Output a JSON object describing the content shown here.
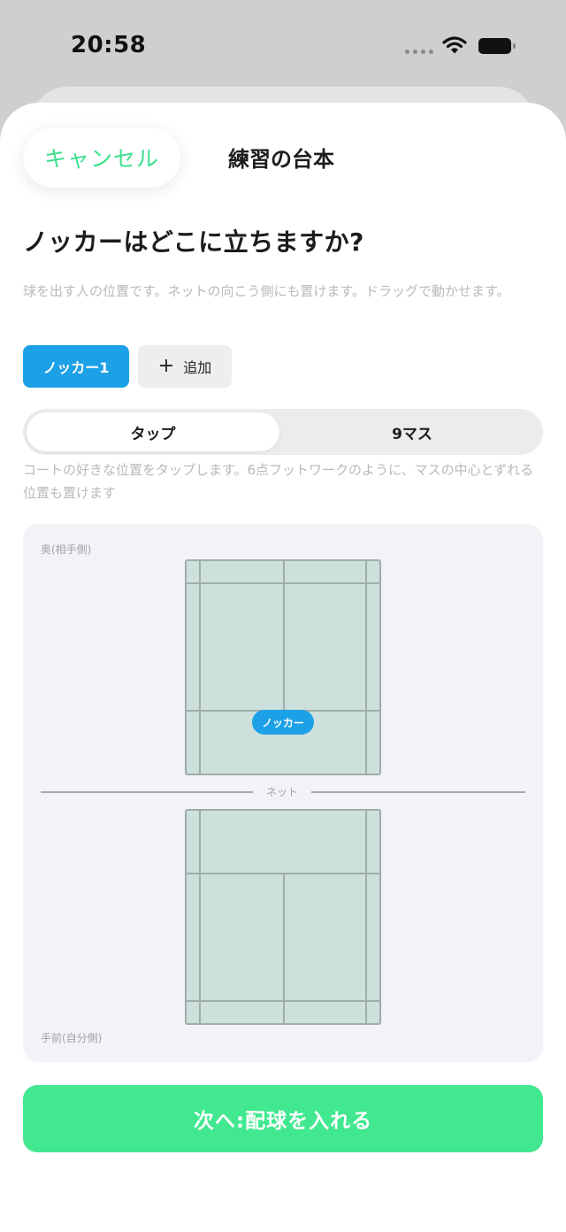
{
  "status_bar": {
    "time": "20:58",
    "wifi_icon": "wifi-icon",
    "battery_icon": "battery-icon"
  },
  "header": {
    "cancel_label": "キャンセル",
    "title": "練習の台本"
  },
  "question": "ノッカーはどこに立ちますか?",
  "description": "球を出す人の位置です。ネットの向こう側にも置けます。ドラッグで動かせます。",
  "chips": {
    "knocker": "ノッカー1",
    "add_icon": "+",
    "add": "追加"
  },
  "mode": {
    "options": [
      "タップ",
      "9マス"
    ],
    "selected": "タップ",
    "hint": "コートの好きな位置をタップします。6点フットワークのように、マスの中心とずれる位置も置けます"
  },
  "court": {
    "label_back": "奥(相手側)",
    "label_front": "手前(自分側)",
    "net_label": "ネット",
    "marker_label": "ノッカー",
    "background_color": "#cde0dc",
    "marker_color": "#1ca1e6"
  },
  "next_button": "次へ:配球を入れる",
  "colors": {
    "accent_green": "#41e88f",
    "cancel_text": "#3fe08e",
    "accent_blue": "#1ca1e6"
  }
}
